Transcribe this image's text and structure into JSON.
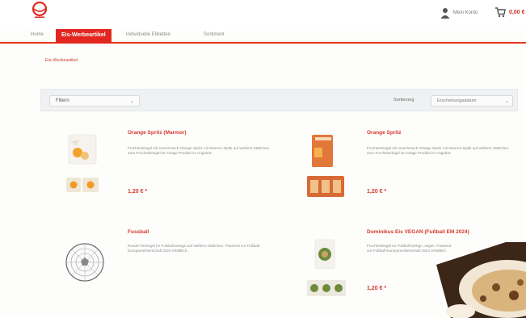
{
  "header": {
    "logo": "brand-logo",
    "account_label": "Mein Konto",
    "cart_value": "0,00 €"
  },
  "nav": {
    "items": [
      {
        "label": "Home"
      },
      {
        "label": "Eis-Werbeartikel"
      },
      {
        "label": "Individuelle Etiketten"
      },
      {
        "label": "Sortiment"
      }
    ],
    "active_index": 1
  },
  "breadcrumb": "Eis-Werbeartikel",
  "filters": {
    "filter_label": "Filtern",
    "sort_label": "Sortierung",
    "sort_value": "Erscheinungsdatum"
  },
  "products": [
    {
      "title": "Orange Spritz (Marmor)",
      "description": "Fruchteisriegel mit Geschmack Orange Spritz mit Marmor-Optik auf weißem Stäbchen. Zum Fruchteisriegel ist Anlage Produkt im Angebot.",
      "price": "1,20 € *"
    },
    {
      "title": "Orange Spritz",
      "description": "Fruchteisriegel mit Geschmack Orange Spritz mit Marmor-Optik auf weißem Stäbchen. Zum Fruchteisriegel ist Anlage Produkt im Angebot.",
      "price": "1,20 € *"
    },
    {
      "title": "Fussball",
      "description": "Runder Eisriegel im Fußball-Design auf weißem Stäbchen. Passend zur Fußball-Europameisterschaft 2024 erhältlich.",
      "price": ""
    },
    {
      "title": "Dominikus Eis VEGAN (Fußball EM 2024)",
      "description": "Fruchteisriegel im Fußball-Design, vegan. Passend zur Fußball-Europameisterschaft 2024 erhältlich.",
      "price": "1,20 € *"
    }
  ]
}
